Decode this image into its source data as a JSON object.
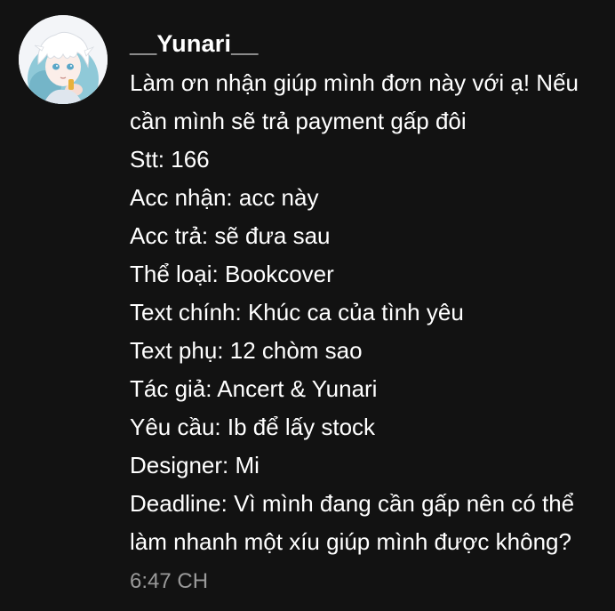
{
  "comment": {
    "author": "__Yunari__",
    "lines": [
      "Làm ơn nhận giúp mình đơn này với ạ! Nếu cần mình sẽ trả payment gấp đôi",
      "Stt: 166",
      "Acc nhận: acc này",
      "Acc trả: sẽ đưa sau",
      "Thể loại: Bookcover",
      "Text chính: Khúc ca của tình yêu",
      "Text phụ: 12 chòm sao",
      "Tác giả: Ancert & Yunari",
      "Yêu cầu: Ib để lấy stock",
      "Designer: Mi",
      "Deadline: Vì mình đang cần gấp nên có thể làm nhanh một xíu giúp mình được không?"
    ],
    "time": "6:47 CH",
    "avatar_icon": "anime-avatar-icon"
  },
  "colors": {
    "background": "#121212",
    "text": "#ffffff",
    "timestamp": "#9a9a9a"
  }
}
